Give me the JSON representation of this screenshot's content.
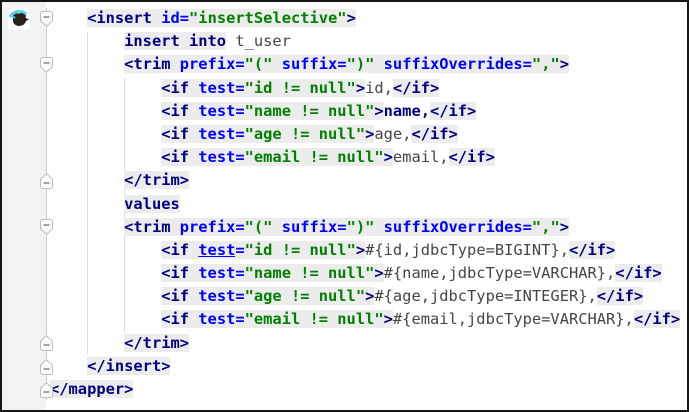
{
  "colors": {
    "editor_bg": "#ffffff",
    "gutter_bg": "#f2f2f2",
    "fold_line": "#cccccc",
    "band": "#ececec",
    "xml_tag": "#000080",
    "attribute": "#0000ff",
    "attr_value": "#008000",
    "sql_keyword": "#000080",
    "sql_text": "#454545"
  },
  "gutter": {
    "icon": "mybatis-bird-icon",
    "fold_markers": [
      {
        "line": 1,
        "type": "collapse-start"
      },
      {
        "line": 3,
        "type": "collapse-start"
      },
      {
        "line": 8,
        "type": "collapse-end"
      },
      {
        "line": 10,
        "type": "collapse-start"
      },
      {
        "line": 15,
        "type": "collapse-end"
      },
      {
        "line": 16,
        "type": "collapse-end"
      },
      {
        "line": 17,
        "type": "collapse-end"
      }
    ]
  },
  "editor": {
    "language": "xml-with-sql",
    "lines": [
      [
        [
          "ind",
          "    "
        ],
        [
          "tag",
          "<insert "
        ],
        [
          "attr",
          "id="
        ],
        [
          "val",
          "\"insertSelective\""
        ],
        [
          "tag",
          ">"
        ]
      ],
      [
        [
          "ind",
          "        "
        ],
        [
          "kw",
          "insert into"
        ],
        [
          "sql",
          " t_user"
        ]
      ],
      [
        [
          "ind",
          "        "
        ],
        [
          "tag",
          "<trim "
        ],
        [
          "attr",
          "prefix="
        ],
        [
          "val",
          "\"(\" "
        ],
        [
          "attr",
          "suffix="
        ],
        [
          "val",
          "\")\" "
        ],
        [
          "attr",
          "suffixOverrides="
        ],
        [
          "val",
          "\",\""
        ],
        [
          "tag",
          ">"
        ]
      ],
      [
        [
          "ind",
          "            "
        ],
        [
          "tag",
          "<if "
        ],
        [
          "attr",
          "test="
        ],
        [
          "val",
          "\"id != null\""
        ],
        [
          "tag",
          ">"
        ],
        [
          "sql",
          "id,"
        ],
        [
          "tag",
          "</if>"
        ]
      ],
      [
        [
          "ind",
          "            "
        ],
        [
          "tag",
          "<if "
        ],
        [
          "attr",
          "test="
        ],
        [
          "val",
          "\"name != null\""
        ],
        [
          "tag",
          ">"
        ],
        [
          "kwp",
          "name,"
        ],
        [
          "tag",
          "</if>"
        ]
      ],
      [
        [
          "ind",
          "            "
        ],
        [
          "tag",
          "<if "
        ],
        [
          "attr",
          "test="
        ],
        [
          "val",
          "\"age != null\""
        ],
        [
          "tag",
          ">"
        ],
        [
          "sql",
          "age,"
        ],
        [
          "tag",
          "</if>"
        ]
      ],
      [
        [
          "ind",
          "            "
        ],
        [
          "tag",
          "<if "
        ],
        [
          "attr",
          "test="
        ],
        [
          "val",
          "\"email != null\""
        ],
        [
          "tag",
          ">"
        ],
        [
          "sql",
          "email,"
        ],
        [
          "tag",
          "</if>"
        ]
      ],
      [
        [
          "ind",
          "        "
        ],
        [
          "tag",
          "</trim>"
        ]
      ],
      [
        [
          "ind",
          "        "
        ],
        [
          "kw",
          "values"
        ]
      ],
      [
        [
          "ind",
          "        "
        ],
        [
          "tag",
          "<trim "
        ],
        [
          "attr",
          "prefix="
        ],
        [
          "val",
          "\"(\" "
        ],
        [
          "attr",
          "suffix="
        ],
        [
          "val",
          "\")\" "
        ],
        [
          "attr",
          "suffixOverrides="
        ],
        [
          "val",
          "\",\""
        ],
        [
          "tag",
          ">"
        ]
      ],
      [
        [
          "ind",
          "            "
        ],
        [
          "tag",
          "<if "
        ],
        [
          "attru",
          "test"
        ],
        [
          "attr",
          "="
        ],
        [
          "val",
          "\"id != null\""
        ],
        [
          "tag",
          ">"
        ],
        [
          "sql",
          "#{id,jdbcType=BIGINT},"
        ],
        [
          "tag",
          "</if>"
        ]
      ],
      [
        [
          "ind",
          "            "
        ],
        [
          "tag",
          "<if "
        ],
        [
          "attr",
          "test="
        ],
        [
          "val",
          "\"name != null\""
        ],
        [
          "tag",
          ">"
        ],
        [
          "sql",
          "#{name,jdbcType=VARCHAR},"
        ],
        [
          "tag",
          "</if>"
        ]
      ],
      [
        [
          "ind",
          "            "
        ],
        [
          "tag",
          "<if "
        ],
        [
          "attr",
          "test="
        ],
        [
          "val",
          "\"age != null\""
        ],
        [
          "tag",
          ">"
        ],
        [
          "sql",
          "#{age,jdbcType=INTEGER},"
        ],
        [
          "tag",
          "</if>"
        ]
      ],
      [
        [
          "ind",
          "            "
        ],
        [
          "tag",
          "<if "
        ],
        [
          "attr",
          "test="
        ],
        [
          "val",
          "\"email != null\""
        ],
        [
          "tag",
          ">"
        ],
        [
          "sql",
          "#{email,jdbcType=VARCHAR},"
        ],
        [
          "tag",
          "</if>"
        ]
      ],
      [
        [
          "ind",
          "        "
        ],
        [
          "tag",
          "</trim>"
        ]
      ],
      [
        [
          "ind",
          "    "
        ],
        [
          "tag",
          "</insert>"
        ]
      ],
      [
        [
          "tag",
          "</mapper>"
        ]
      ]
    ]
  }
}
